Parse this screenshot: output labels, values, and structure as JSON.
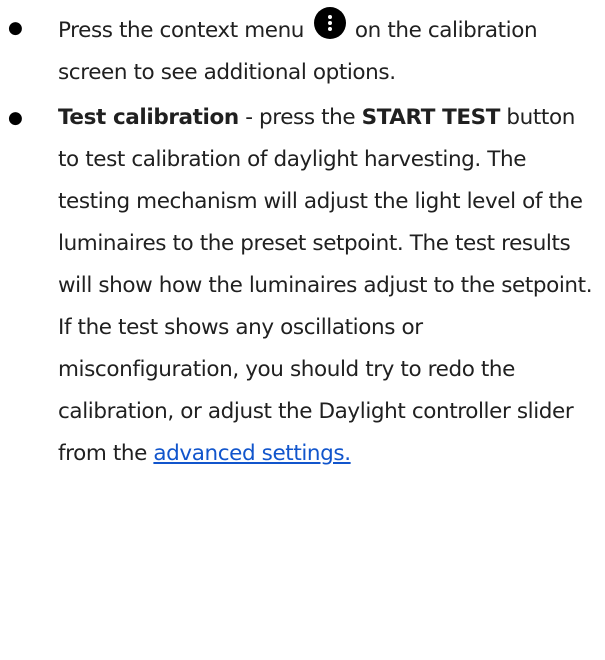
{
  "items": [
    {
      "bullet": "●",
      "text_before_icon": "Press the context menu",
      "icon": "more-vertical-icon",
      "text_after_icon": " on the calibration screen to see additional options."
    },
    {
      "bullet": "●",
      "title": "Test calibration",
      "text_1": " - press the ",
      "button_name": "START TEST",
      "text_2": " button to test calibration of daylight harvesting. The testing mechanism will adjust the light level of the luminaires to the preset setpoint.  The  test results will show how the luminaires adjust to the setpoint. If the test shows any oscillations or misconfiguration, you should try to redo the calibration, or adjust the  Daylight controller slider from the ",
      "link_text": "advanced settings."
    }
  ],
  "colors": {
    "text": "#202020",
    "link": "#1155cc",
    "icon_bg": "#000000"
  }
}
